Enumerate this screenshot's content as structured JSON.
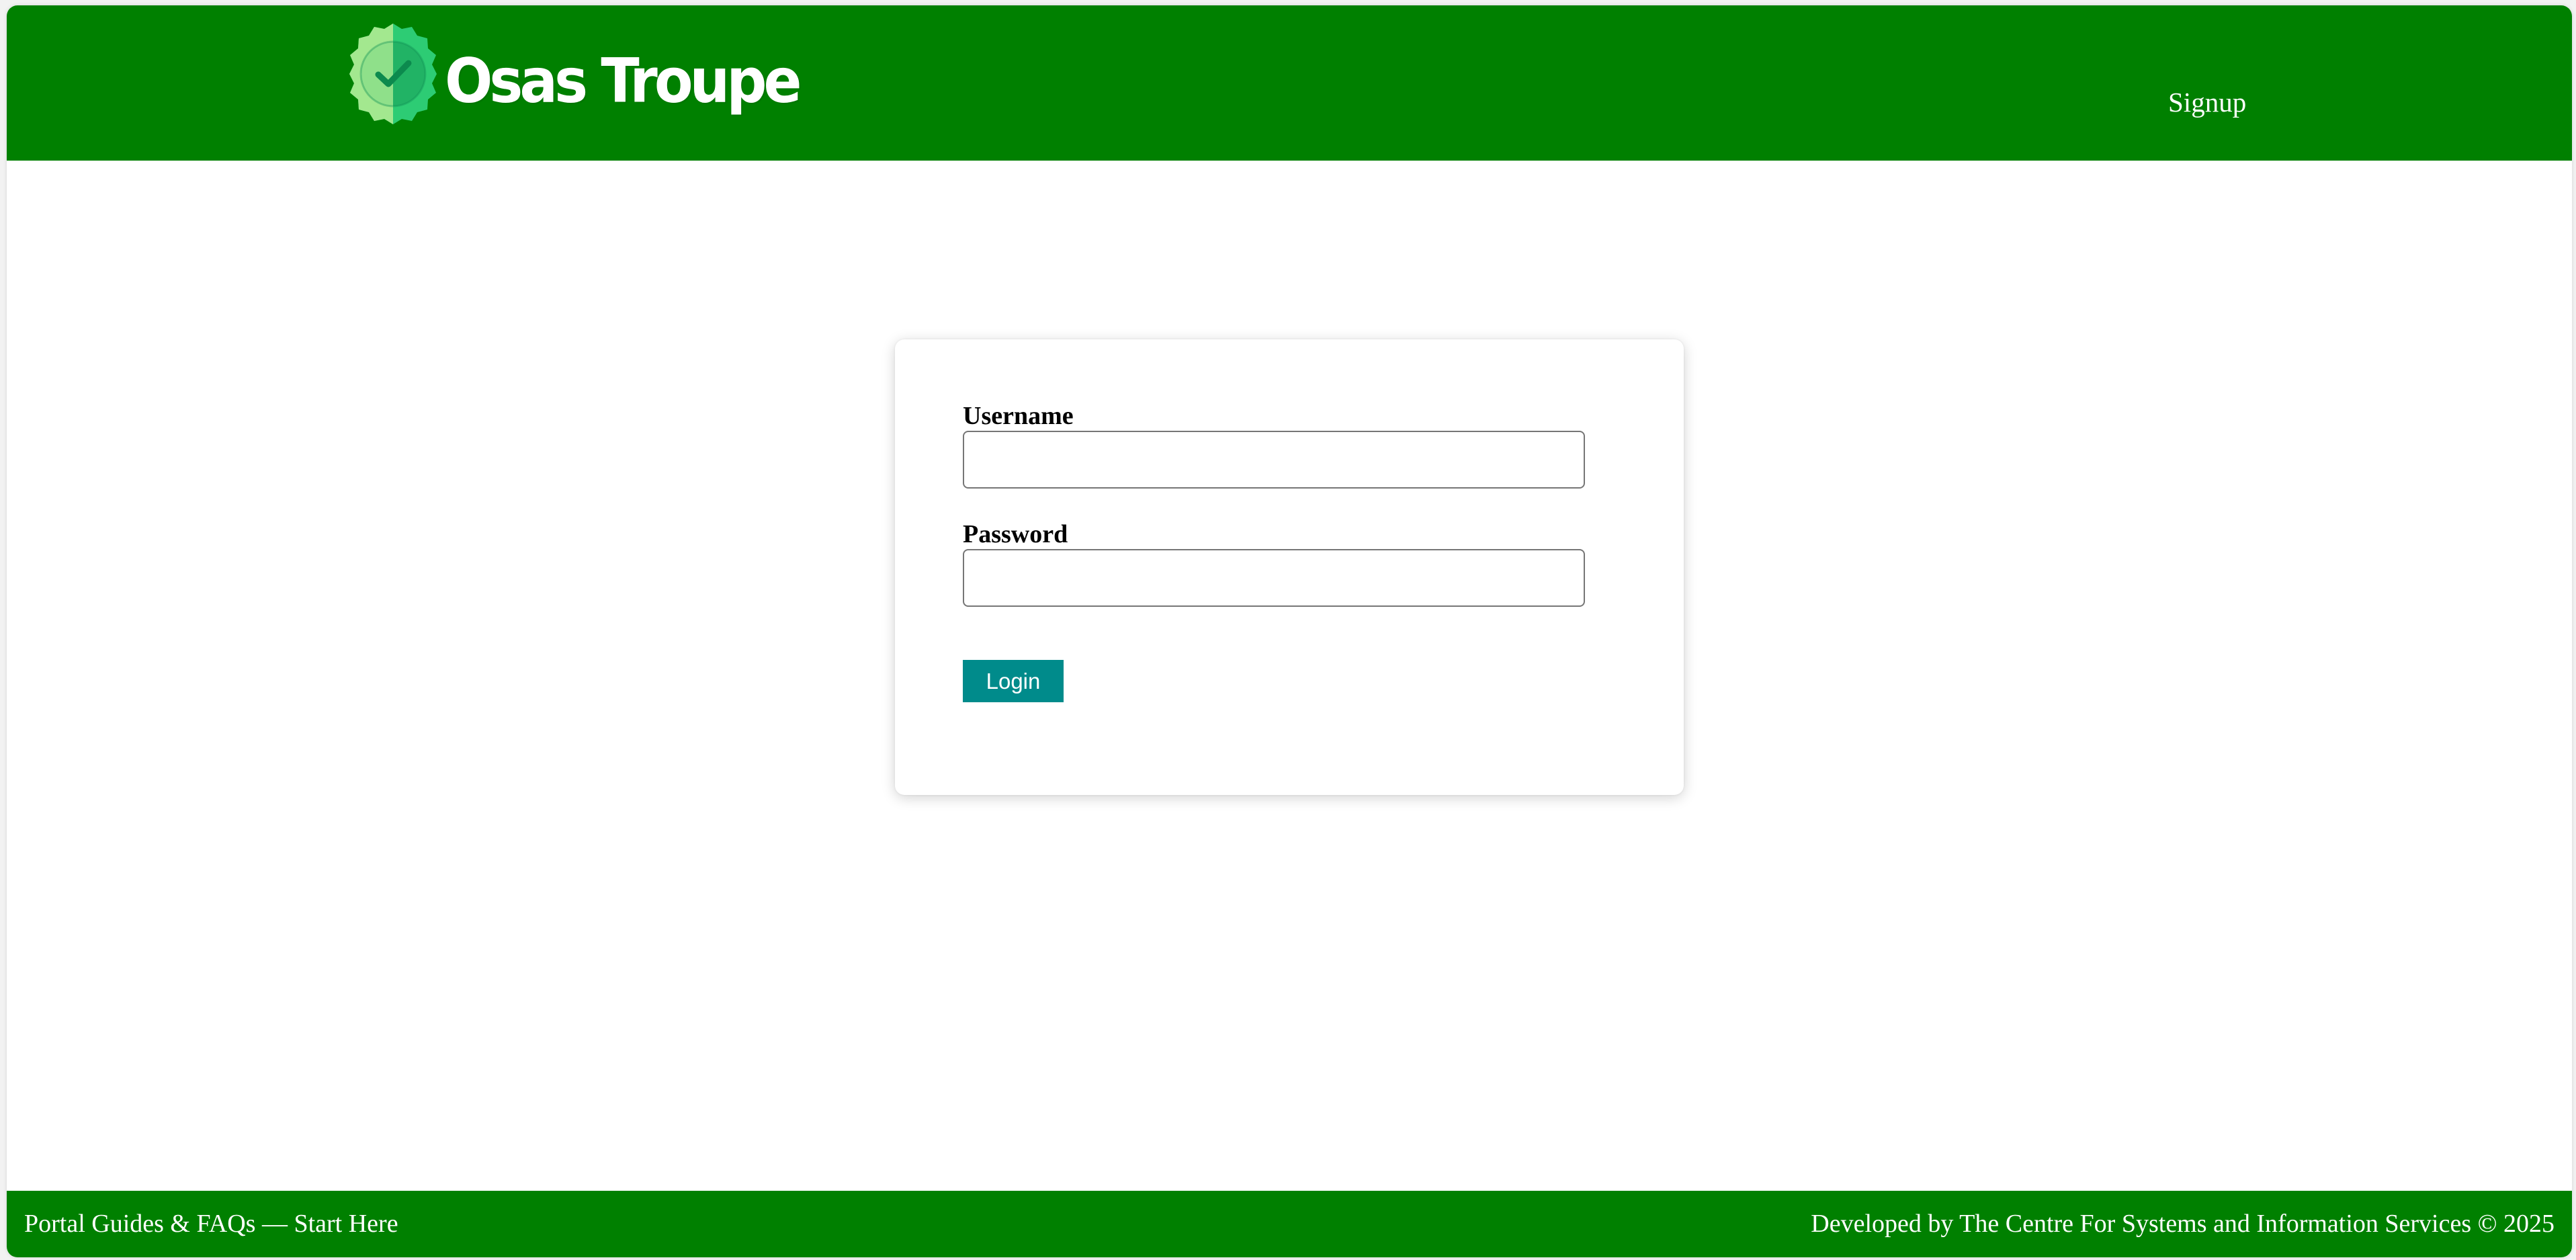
{
  "header": {
    "brand_name": "Osas Troupe",
    "signup_label": "Signup"
  },
  "login_form": {
    "username_label": "Username",
    "username_value": "",
    "password_label": "Password",
    "password_value": "",
    "login_label": "Login"
  },
  "footer": {
    "guides_link": "Portal Guides & FAQs — Start Here",
    "credit": "Developed by The Centre For Systems and Information Services © 2025"
  },
  "colors": {
    "header_bg": "#008000",
    "footer_bg": "#008000",
    "button_bg": "#008B8B",
    "badge_light": "#A3E88F",
    "badge_dark": "#2DCC74"
  },
  "icons": {
    "logo": "check-badge-icon"
  }
}
